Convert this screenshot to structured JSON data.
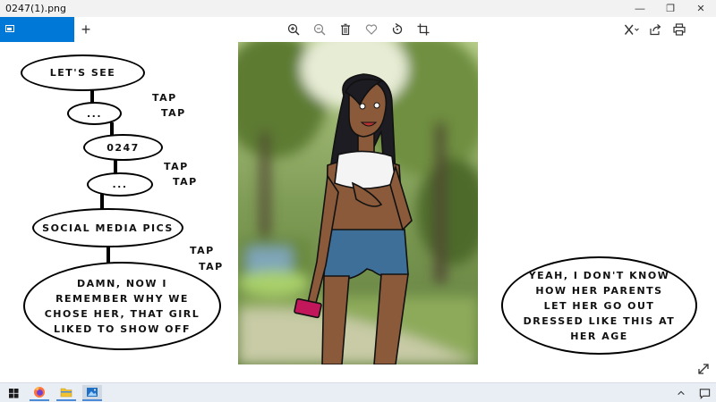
{
  "window": {
    "title": "0247(1).png",
    "controls": {
      "minimize": "—",
      "restore": "❐",
      "close": "✕"
    }
  },
  "toolbar": {
    "tab_icon": "image-icon",
    "add_tab": "+",
    "actions": [
      "zoom-in-icon",
      "zoom-out-icon",
      "delete-icon",
      "favorite-icon",
      "rotate-icon",
      "crop-icon"
    ],
    "right_actions": [
      "edit-icon",
      "share-icon",
      "print-icon"
    ]
  },
  "comic": {
    "bubbles": {
      "lets_see": "LET'S SEE",
      "dots1": "...",
      "code": "0247",
      "dots2": "...",
      "social": "SOCIAL MEDIA PICS",
      "damn": "DAMN, NOW I REMEMBER WHY WE CHOSE HER, THAT GIRL LIKED TO SHOW OFF",
      "yeah": "YEAH, I DON'T KNOW HOW HER PARENTS LET HER GO OUT DRESSED LIKE THIS AT HER AGE"
    },
    "sfx": [
      "TAP",
      "TAP",
      "TAP",
      "TAP",
      "TAP",
      "TAP"
    ]
  },
  "taskbar": {
    "apps": [
      "windows-start-icon",
      "firefox-icon",
      "file-explorer-icon",
      "photos-icon"
    ],
    "tray": [
      "chevron-up-icon",
      "notification-icon"
    ]
  }
}
